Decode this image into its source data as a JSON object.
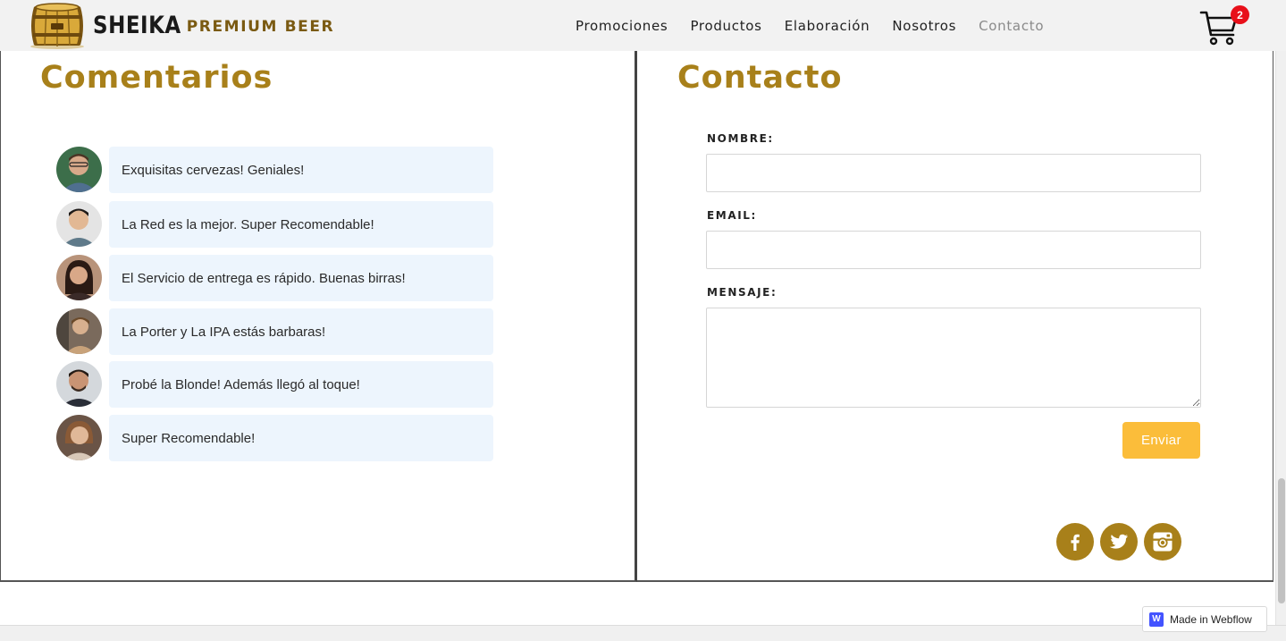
{
  "brand": {
    "name": "SHEIKA",
    "tagline": "PREMIUM BEER"
  },
  "nav": {
    "items": [
      {
        "label": "Promociones"
      },
      {
        "label": "Productos"
      },
      {
        "label": "Elaboración"
      },
      {
        "label": "Nosotros"
      },
      {
        "label": "Contacto",
        "current": true
      }
    ],
    "cart_count": "2"
  },
  "comments": {
    "title": "Comentarios",
    "items": [
      {
        "text": "Exquisitas cervezas! Geniales!"
      },
      {
        "text": "La Red es la mejor. Super Recomendable!"
      },
      {
        "text": "El Servicio de entrega es rápido. Buenas birras!"
      },
      {
        "text": "La Porter y La IPA estás barbaras!"
      },
      {
        "text": "Probé la Blonde! Además llegó al toque!"
      },
      {
        "text": "Super Recomendable!"
      }
    ]
  },
  "contact": {
    "title": "Contacto",
    "name_label": "NOMBRE:",
    "name_value": "",
    "email_label": "EMAIL:",
    "email_value": "",
    "message_label": "MENSAJE:",
    "message_value": "",
    "submit_label": "Enviar",
    "social": [
      "facebook-icon",
      "twitter-icon",
      "instagram-icon"
    ]
  },
  "footer": {
    "badge_label": "Made in Webflow",
    "badge_logo": "W"
  },
  "colors": {
    "accent": "#a8801a",
    "button": "#fbbd3a",
    "bubble": "#edf5fd",
    "badge": "#e8101a"
  }
}
